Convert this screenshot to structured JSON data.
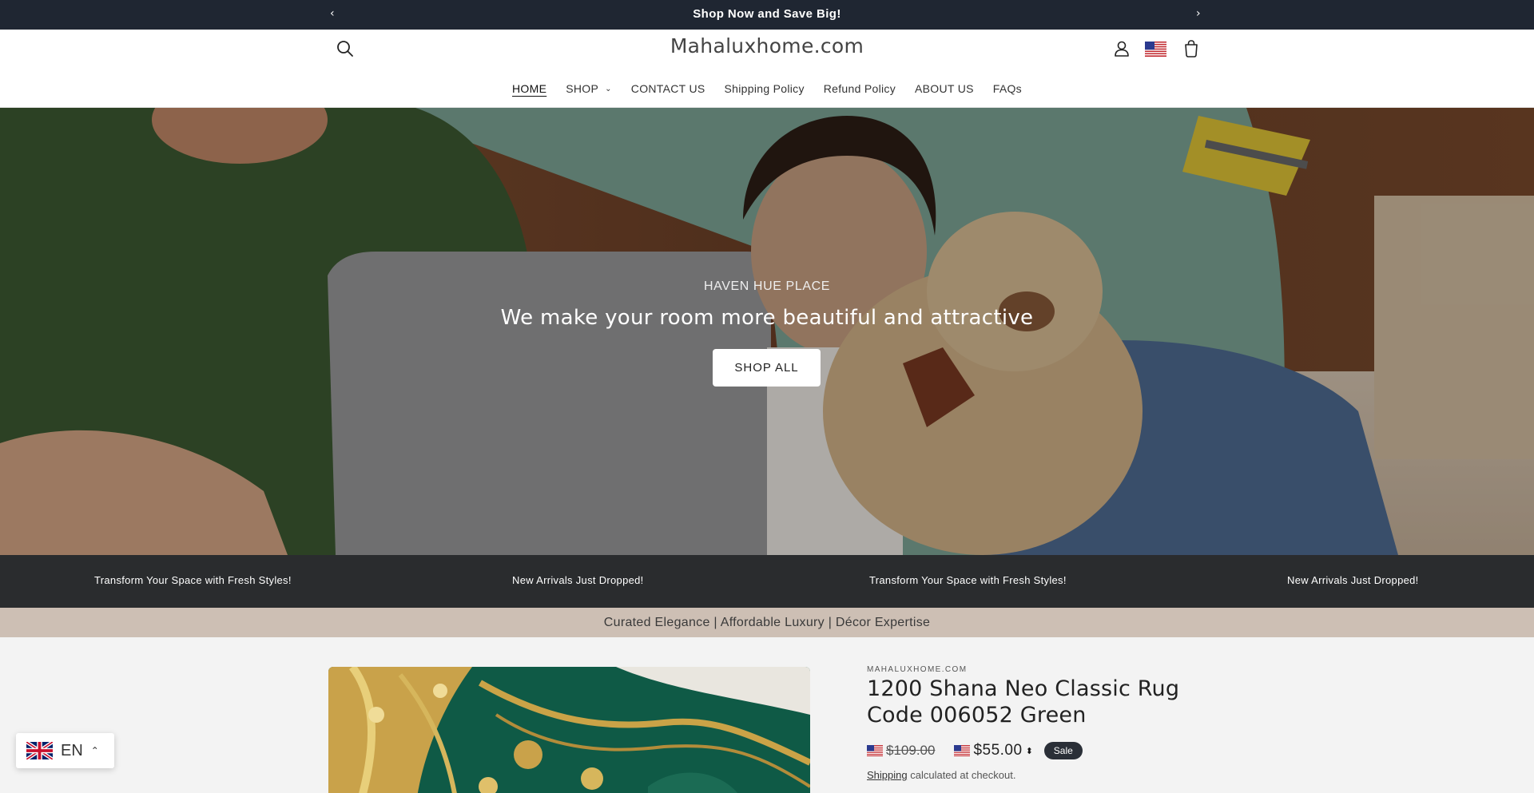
{
  "announcement": {
    "message": "Shop Now and Save Big!",
    "prev_icon": "‹",
    "next_icon": "›"
  },
  "header": {
    "logo": "Mahaluxhome.com",
    "icons": [
      "search-icon",
      "account-icon",
      "us-flag-icon",
      "cart-icon"
    ]
  },
  "nav": {
    "items": [
      {
        "label": "HOME",
        "active": true
      },
      {
        "label": "SHOP",
        "dropdown": true
      },
      {
        "label": "CONTACT US"
      },
      {
        "label": "Shipping Policy"
      },
      {
        "label": "Refund Policy"
      },
      {
        "label": "ABOUT US"
      },
      {
        "label": "FAQs"
      }
    ],
    "dropdown_icon": "⌄"
  },
  "hero": {
    "subheading": "HAVEN HUE PLACE",
    "heading": "We make your room more beautiful and attractive",
    "button": "SHOP ALL"
  },
  "marquee": {
    "items": [
      "Transform Your Space with Fresh Styles!",
      "New Arrivals Just Dropped!",
      "Transform Your Space with Fresh Styles!",
      "New Arrivals Just Dropped!"
    ]
  },
  "tagline": "Curated Elegance | Affordable Luxury | Décor Expertise",
  "product": {
    "vendor": "MAHALUXHOME.COM",
    "title": "1200 Shana Neo Classic Rug Code 006052 Green",
    "compare_price": "$109.00",
    "price": "$55.00",
    "price_toggle": "⬍",
    "badge": "Sale",
    "shipping_link": "Shipping",
    "shipping_text": " calculated at checkout."
  },
  "language": {
    "code": "EN",
    "chevron": "⌃"
  },
  "colors": {
    "announcement_bg": "#1f2632",
    "marquee_bg": "#2a2c2e",
    "tagline_bg": "#cdbfb4",
    "badge_bg": "#2a2f37",
    "page_bg": "#f3f3f3"
  }
}
